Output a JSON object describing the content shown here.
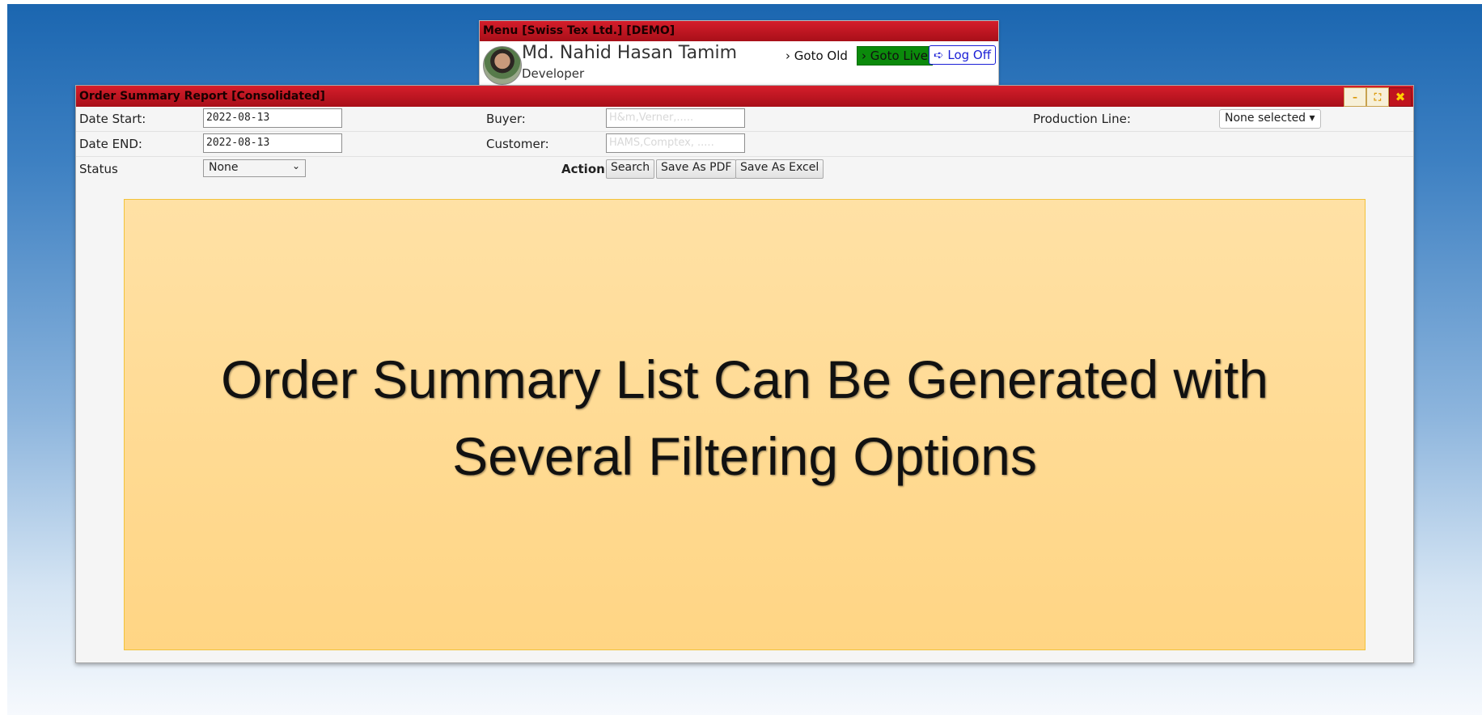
{
  "menu": {
    "title": "Menu [Swiss Tex Ltd.] [DEMO]",
    "user_name": "Md. Nahid Hasan Tamim",
    "user_role": "Developer",
    "goto_old": "Goto Old",
    "goto_live": "Goto Live",
    "logoff": "Log Off"
  },
  "report": {
    "title": "Order Summary Report [Consolidated]",
    "window_buttons": {
      "minimize": "–",
      "maximize": "⛶",
      "close": "✖"
    },
    "fields": {
      "date_start_label": "Date Start:",
      "date_start_value": "2022-08-13",
      "date_end_label": "Date END:",
      "date_end_value": "2022-08-13",
      "status_label": "Status",
      "status_value": "None",
      "buyer_label": "Buyer:",
      "buyer_placeholder": "H&m,Verner,.....",
      "customer_label": "Customer:",
      "customer_placeholder": "HAMS,Comptex, .....",
      "production_line_label": "Production Line:",
      "production_line_value": "None selected"
    },
    "actions": {
      "label": "Action:",
      "search": "Search",
      "save_pdf": "Save As PDF",
      "save_excel": "Save As Excel"
    },
    "banner": "Order Summary List Can Be Generated with Several Filtering Options"
  },
  "colors": {
    "title_bar": "#c1141e",
    "goto_live_bg": "#0b8a0b",
    "logoff_text": "#1a1fd6",
    "banner_bg": "#ffd584"
  },
  "icons": {
    "goto_old": "chevron-right-icon",
    "goto_live": "chevron-right-icon",
    "logoff": "sign-out-icon",
    "status_dropdown": "chevron-down-icon",
    "production_line_dropdown": "caret-down-icon"
  }
}
